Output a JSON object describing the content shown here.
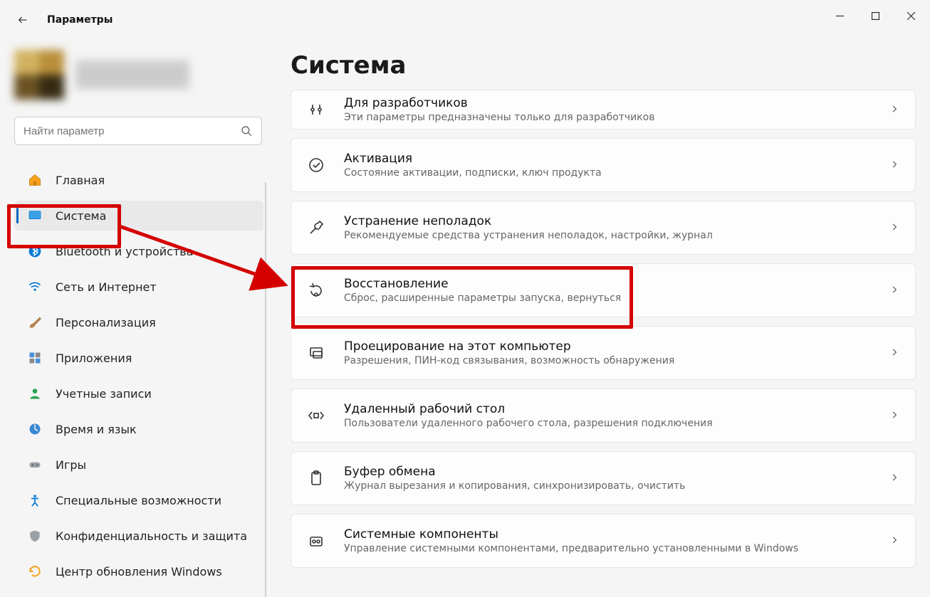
{
  "window": {
    "app_title": "Параметры"
  },
  "search": {
    "placeholder": "Найти параметр"
  },
  "sidebar": {
    "items": [
      {
        "id": "home",
        "label": "Главная"
      },
      {
        "id": "system",
        "label": "Система",
        "active": true
      },
      {
        "id": "bluetooth",
        "label": "Bluetooth и устройства"
      },
      {
        "id": "network",
        "label": "Сеть и Интернет"
      },
      {
        "id": "personalize",
        "label": "Персонализация"
      },
      {
        "id": "apps",
        "label": "Приложения"
      },
      {
        "id": "accounts",
        "label": "Учетные записи"
      },
      {
        "id": "time",
        "label": "Время и язык"
      },
      {
        "id": "gaming",
        "label": "Игры"
      },
      {
        "id": "accessibility",
        "label": "Специальные возможности"
      },
      {
        "id": "privacy",
        "label": "Конфиденциальность и защита"
      },
      {
        "id": "update",
        "label": "Центр обновления Windows"
      }
    ]
  },
  "page": {
    "title": "Система",
    "cards": [
      {
        "id": "dev",
        "title": "Для разработчиков",
        "sub": "Эти параметры предназначены только для разработчиков"
      },
      {
        "id": "activation",
        "title": "Активация",
        "sub": "Состояние активации, подписки, ключ продукта"
      },
      {
        "id": "troubleshoot",
        "title": "Устранение неполадок",
        "sub": "Рекомендуемые средства устранения неполадок, настройки, журнал"
      },
      {
        "id": "recovery",
        "title": "Восстановление",
        "sub": "Сброс, расширенные параметры запуска, вернуться"
      },
      {
        "id": "project",
        "title": "Проецирование на этот компьютер",
        "sub": "Разрешения, ПИН-код связывания, возможность обнаружения"
      },
      {
        "id": "rdp",
        "title": "Удаленный рабочий стол",
        "sub": "Пользователи удаленного рабочего стола, разрешения подключения"
      },
      {
        "id": "clipboard",
        "title": "Буфер обмена",
        "sub": "Журнал вырезания и копирования, синхронизировать, очистить"
      },
      {
        "id": "components",
        "title": "Системные компоненты",
        "sub": "Управление системными компонентами, предварительно установленными в Windows"
      }
    ]
  }
}
